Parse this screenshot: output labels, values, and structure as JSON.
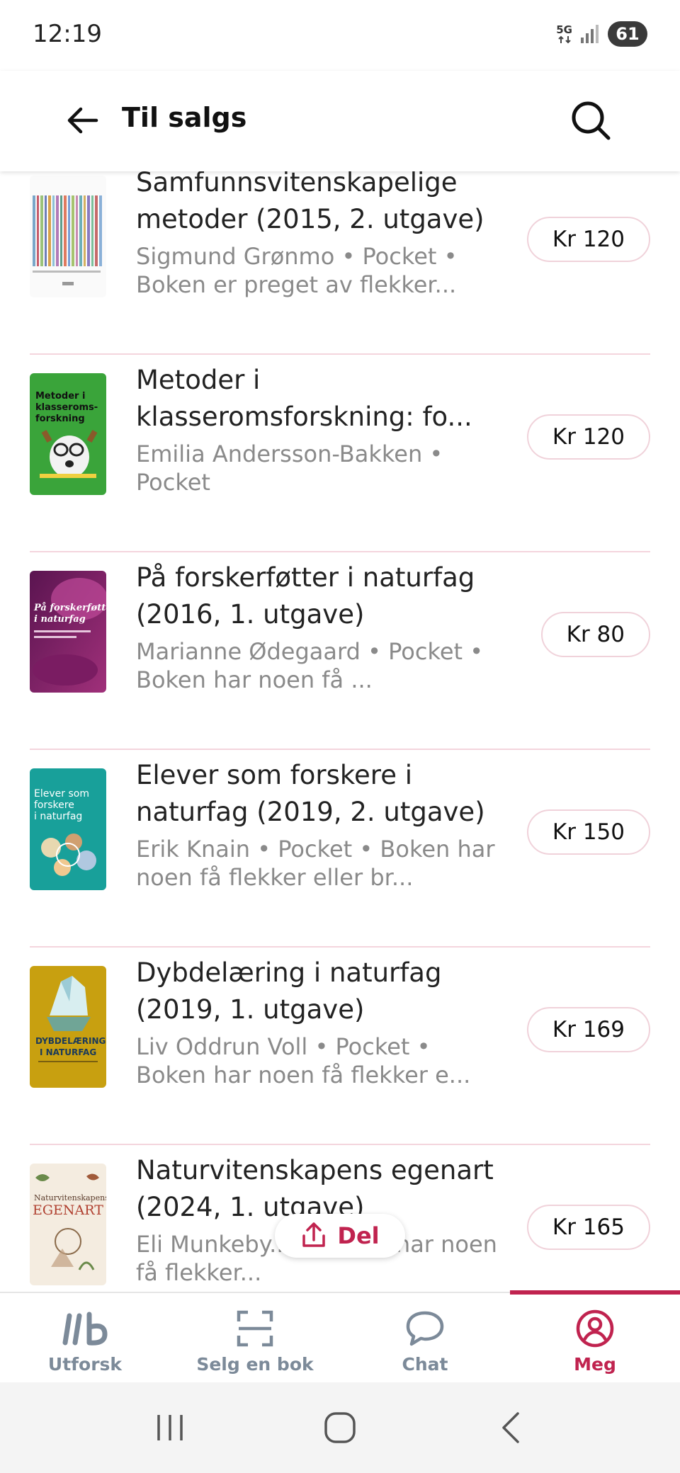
{
  "status": {
    "time": "12:19",
    "network": "5G",
    "battery": "61"
  },
  "header": {
    "title": "Til salgs"
  },
  "books": [
    {
      "title": "Samfunnsvitenskapelige metoder (2015, 2. utgave)",
      "meta": "Sigmund Grønmo • Pocket • Boken er preget av flekker...",
      "price": "Kr 120",
      "cover": "stripes"
    },
    {
      "title": "Metoder i klasseromsforskning: fo...",
      "meta": "Emilia Andersson-Bakken • Pocket",
      "price": "Kr 120",
      "cover": "green-dog"
    },
    {
      "title": "På forskerføtter i naturfag (2016, 1. utgave)",
      "meta": "Marianne Ødegaard • Pocket • Boken har noen få ...",
      "price": "Kr 80",
      "cover": "purple-flower"
    },
    {
      "title": "Elever som forskere i naturfag (2019, 2. utgave)",
      "meta": "Erik Knain • Pocket • Boken har noen få flekker eller br...",
      "price": "Kr 150",
      "cover": "teal"
    },
    {
      "title": "Dybdelæring i naturfag (2019, 1. utgave)",
      "meta": "Liv Oddrun Voll • Pocket • Boken har noen få flekker e...",
      "price": "Kr 169",
      "cover": "yellow-iceberg"
    },
    {
      "title": "Naturvitenskapens egenart (2024, 1. utgave)",
      "meta": "Eli Munkeby... • Boken har noen få flekker...",
      "price": "Kr 165",
      "cover": "botanical"
    }
  ],
  "covers": {
    "c2_title": "Metoder i klasseroms-forskning",
    "c3_title": "På forskerføtter i naturfag",
    "c4_title": "Elever som forskere i naturfag",
    "c5_title": "DYBDELÆRING I NATURFAG",
    "c6_title": "Naturvitenskapens EGENART"
  },
  "share": {
    "label": "Del"
  },
  "nav": {
    "items": [
      {
        "label": "Utforsk",
        "icon": "explore-icon"
      },
      {
        "label": "Selg en bok",
        "icon": "scan-icon"
      },
      {
        "label": "Chat",
        "icon": "chat-icon"
      },
      {
        "label": "Meg",
        "icon": "profile-icon"
      }
    ],
    "active_index": 3
  },
  "colors": {
    "accent": "#c0234f",
    "divider": "#f4d5dd",
    "meta_text": "#8a8a8a"
  }
}
